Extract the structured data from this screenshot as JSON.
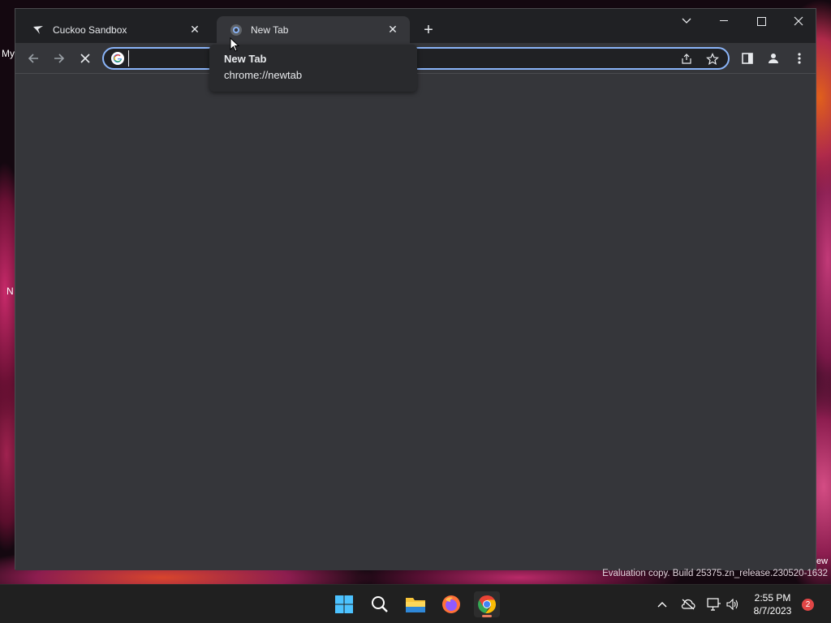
{
  "desktop": {
    "fragments": [
      {
        "label": "My"
      },
      {
        "label": "N"
      },
      {
        "label": "ew"
      }
    ],
    "watermark": "Evaluation copy. Build 25375.zn_release.230520-1632"
  },
  "browser": {
    "tabs": [
      {
        "title": "Cuckoo Sandbox",
        "favicon": "cuckoo-icon",
        "active": false
      },
      {
        "title": "New Tab",
        "favicon": "chrome-newtab-icon",
        "active": true
      }
    ],
    "omnibox": {
      "value": "",
      "search_engine_icon": "google-icon"
    },
    "tooltip": {
      "title": "New Tab",
      "url": "chrome://newtab"
    },
    "accent_color": "#8ab4f8",
    "background_color": "#35363a"
  },
  "taskbar": {
    "apps": [
      "windows-start-icon",
      "search-icon",
      "file-explorer-icon",
      "firefox-icon",
      "chrome-icon"
    ],
    "active_app": "chrome-icon",
    "clock": {
      "time": "2:55 PM",
      "date": "8/7/2023"
    },
    "notifications": "2"
  }
}
